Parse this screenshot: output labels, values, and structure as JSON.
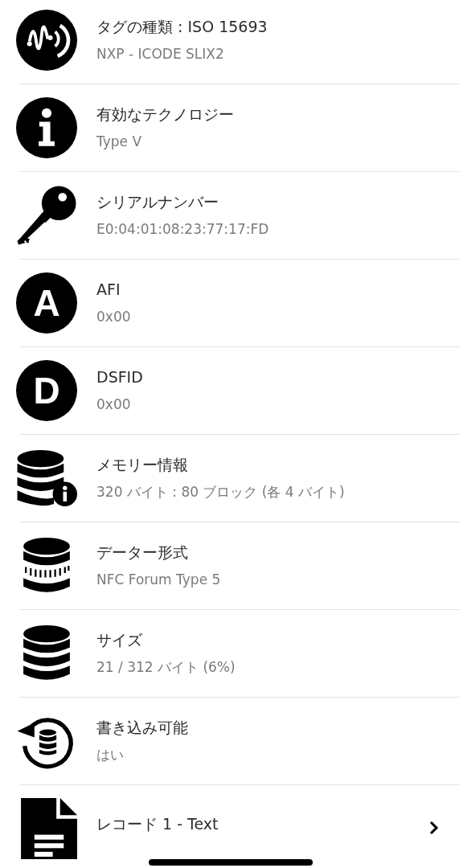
{
  "rows": [
    {
      "kind": "wave",
      "title": "タグの種類 : ISO 15693",
      "subtitle": "NXP - ICODE SLIX2",
      "navigable": false
    },
    {
      "kind": "info",
      "title": "有効なテクノロジー",
      "subtitle": "Type V",
      "navigable": false
    },
    {
      "kind": "key",
      "title": "シリアルナンバー",
      "subtitle": "E0:04:01:08:23:77:17:FD",
      "navigable": false
    },
    {
      "kind": "letter",
      "letter": "A",
      "title": "AFI",
      "subtitle": "0x00",
      "navigable": false
    },
    {
      "kind": "letter",
      "letter": "D",
      "title": "DSFID",
      "subtitle": "0x00",
      "navigable": false
    },
    {
      "kind": "memory",
      "title": "メモリー情報",
      "subtitle": "320 バイト : 80 ブロック (各 4 バイト)",
      "navigable": false
    },
    {
      "kind": "format",
      "title": "データー形式",
      "subtitle": "NFC Forum Type 5",
      "navigable": false
    },
    {
      "kind": "size",
      "title": "サイズ",
      "subtitle": "21 / 312 バイト (6%)",
      "navigable": false
    },
    {
      "kind": "writable",
      "title": "書き込み可能",
      "subtitle": "はい",
      "navigable": false
    },
    {
      "kind": "record",
      "title": "レコード 1 - Text",
      "navigable": true
    }
  ]
}
